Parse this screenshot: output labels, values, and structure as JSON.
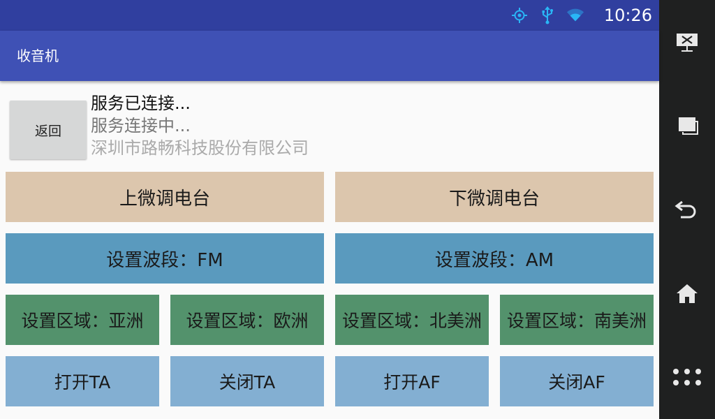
{
  "status_bar": {
    "time": "10:26",
    "icons": [
      "gps-icon",
      "usb-icon",
      "wifi-icon"
    ]
  },
  "app_bar": {
    "title": "收音机"
  },
  "connection": {
    "back_label": "返回",
    "status_connected": "服务已连接...",
    "status_connecting": "服务连接中...",
    "company": "深圳市路畅科技股份有限公司"
  },
  "buttons": {
    "tune_up": "上微调电台",
    "tune_down": "下微调电台",
    "band_fm": "设置波段：FM",
    "band_am": "设置波段：AM",
    "region_asia": "设置区域：亚洲",
    "region_europe": "设置区域：欧洲",
    "region_north_america": "设置区域：北美洲",
    "region_south_america": "设置区域：南美洲",
    "ta_on": "打开TA",
    "ta_off": "关闭TA",
    "af_on": "打开AF",
    "af_off": "关闭AF"
  },
  "nav_bar": {
    "icons": [
      "screenshot-icon",
      "recents-icon",
      "back-icon",
      "home-icon",
      "apps-icon"
    ]
  },
  "colors": {
    "status_bar": "#303f9f",
    "app_bar": "#3f51b5",
    "tune_buttons": "#dcc6ad",
    "band_buttons": "#5a9abe",
    "region_buttons": "#53926c",
    "ta_af_buttons": "#83afd2",
    "nav_bar": "#1f2020"
  }
}
